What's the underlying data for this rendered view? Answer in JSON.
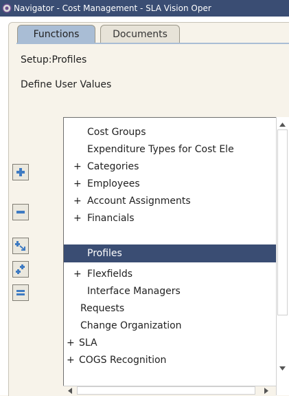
{
  "window": {
    "title": "Navigator - Cost Management - SLA Vision Oper"
  },
  "tabs": [
    {
      "label": "Functions"
    },
    {
      "label": "Documents"
    }
  ],
  "path_label": "Setup:Profiles",
  "section_label": "Define User Values",
  "tree": {
    "items": [
      {
        "prefix": "",
        "text": "Cost Groups"
      },
      {
        "prefix": "",
        "text": "Expenditure Types for Cost Ele"
      },
      {
        "prefix": "+",
        "text": "Categories"
      },
      {
        "prefix": "+",
        "text": "Employees"
      },
      {
        "prefix": "+",
        "text": "Account Assignments"
      },
      {
        "prefix": "+",
        "text": "Financials"
      },
      {
        "prefix": "",
        "text": "Profiles",
        "selected": true
      },
      {
        "prefix": "+",
        "text": "Flexfields"
      },
      {
        "prefix": "",
        "text": "Interface Managers"
      },
      {
        "prefix": "",
        "text": "Requests"
      },
      {
        "prefix": "",
        "text": "Change Organization"
      },
      {
        "prefix": "+",
        "text": "SLA"
      },
      {
        "prefix": "+",
        "text": "COGS Recognition"
      }
    ]
  },
  "colors": {
    "selection": "#3a4d73",
    "active_tab": "#a9bdd5",
    "background": "#f7f3ea"
  },
  "icons": {
    "expand": "plus-icon",
    "collapse": "minus-icon",
    "expand_branch": "expand-branch-icon",
    "expand_all": "expand-all-icon",
    "collapse_all": "collapse-all-icon"
  }
}
